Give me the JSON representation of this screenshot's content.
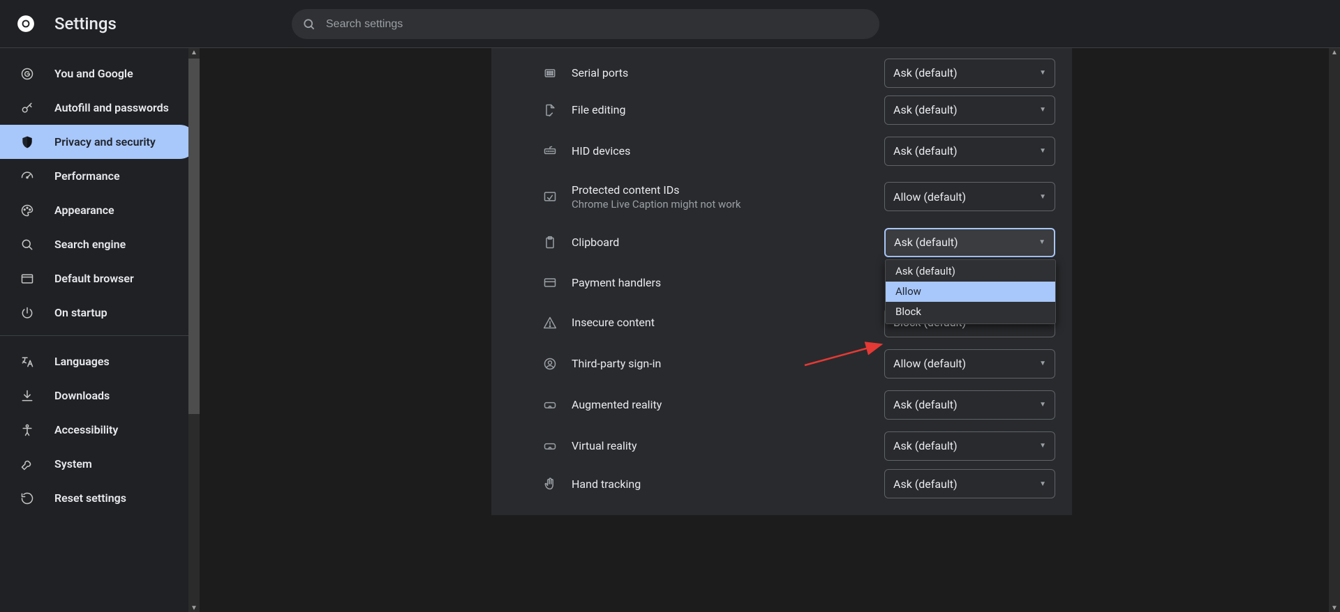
{
  "header": {
    "title": "Settings",
    "search_placeholder": "Search settings"
  },
  "sidebar": {
    "items": [
      {
        "label": "You and Google",
        "icon": "google"
      },
      {
        "label": "Autofill and passwords",
        "icon": "key"
      },
      {
        "label": "Privacy and security",
        "icon": "shield",
        "active": true
      },
      {
        "label": "Performance",
        "icon": "gauge"
      },
      {
        "label": "Appearance",
        "icon": "palette"
      },
      {
        "label": "Search engine",
        "icon": "search"
      },
      {
        "label": "Default browser",
        "icon": "window"
      },
      {
        "label": "On startup",
        "icon": "power"
      }
    ],
    "items2": [
      {
        "label": "Languages",
        "icon": "translate"
      },
      {
        "label": "Downloads",
        "icon": "download"
      },
      {
        "label": "Accessibility",
        "icon": "accessibility"
      },
      {
        "label": "System",
        "icon": "wrench"
      },
      {
        "label": "Reset settings",
        "icon": "reset"
      }
    ]
  },
  "permissions": [
    {
      "title": "Serial ports",
      "sub": "",
      "value": "Ask (default)",
      "icon": "serial"
    },
    {
      "title": "File editing",
      "sub": "",
      "value": "Ask (default)",
      "icon": "file-edit"
    },
    {
      "title": "HID devices",
      "sub": "",
      "value": "Ask (default)",
      "icon": "hid"
    },
    {
      "title": "Protected content IDs",
      "sub": "Chrome Live Caption might not work",
      "value": "Allow (default)",
      "icon": "protected"
    },
    {
      "title": "Clipboard",
      "sub": "",
      "value": "Ask (default)",
      "icon": "clipboard",
      "open": true
    },
    {
      "title": "Payment handlers",
      "sub": "",
      "value": "",
      "icon": "payment"
    },
    {
      "title": "Insecure content",
      "sub": "",
      "value": "Block (default)",
      "icon": "warning"
    },
    {
      "title": "Third-party sign-in",
      "sub": "",
      "value": "Allow (default)",
      "icon": "signin"
    },
    {
      "title": "Augmented reality",
      "sub": "",
      "value": "Ask (default)",
      "icon": "vr"
    },
    {
      "title": "Virtual reality",
      "sub": "",
      "value": "Ask (default)",
      "icon": "vr"
    },
    {
      "title": "Hand tracking",
      "sub": "",
      "value": "Ask (default)",
      "icon": "hand"
    }
  ],
  "dropdown_options": [
    "Ask (default)",
    "Allow",
    "Block"
  ]
}
